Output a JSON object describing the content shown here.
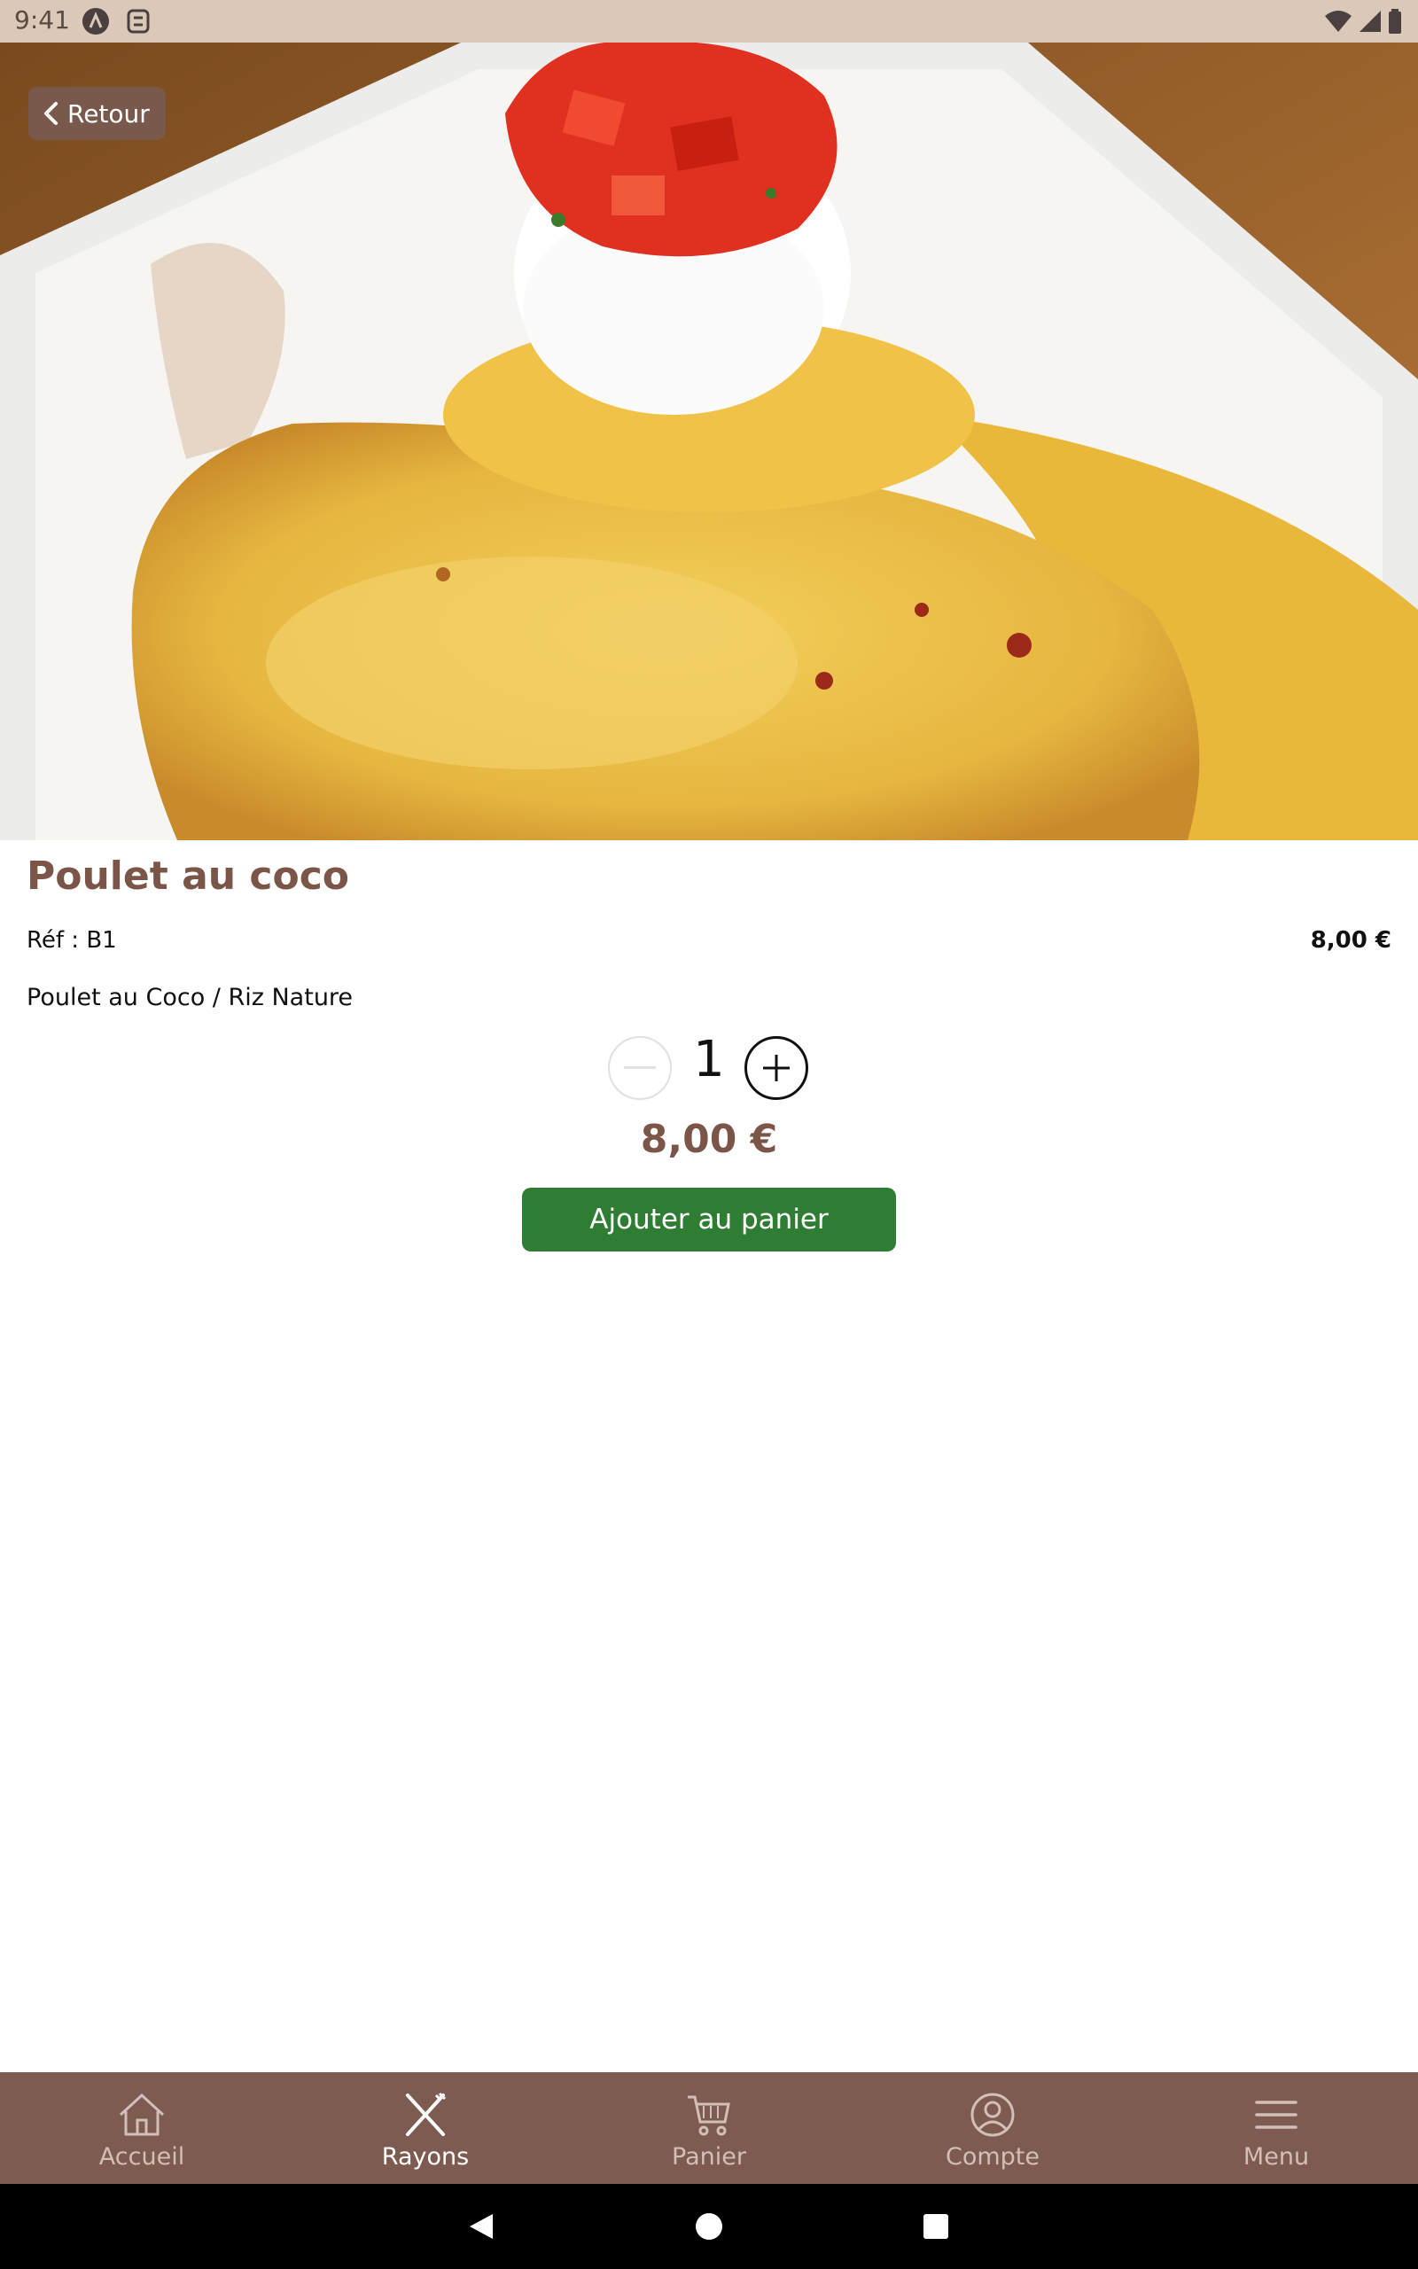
{
  "status_bar": {
    "time": "9:41"
  },
  "header": {
    "back_label": "Retour"
  },
  "product": {
    "title": "Poulet au coco",
    "ref": "Réf : B1",
    "unit_price": "8,00 €",
    "description": "Poulet au Coco / Riz Nature",
    "quantity": "1",
    "total_price": "8,00 €",
    "add_to_cart_label": "Ajouter au panier"
  },
  "bottom_nav": {
    "items": [
      {
        "label": "Accueil",
        "icon": "home-icon",
        "active": false
      },
      {
        "label": "Rayons",
        "icon": "fork-knife-icon",
        "active": true
      },
      {
        "label": "Panier",
        "icon": "cart-icon",
        "active": false
      },
      {
        "label": "Compte",
        "icon": "account-icon",
        "active": false
      },
      {
        "label": "Menu",
        "icon": "hamburger-menu-icon",
        "active": false
      }
    ]
  },
  "colors": {
    "brand_brown": "#7a5548",
    "nav_background": "#7d5b50",
    "button_green": "#2e7d32",
    "status_bar": "#dcc8b8"
  }
}
